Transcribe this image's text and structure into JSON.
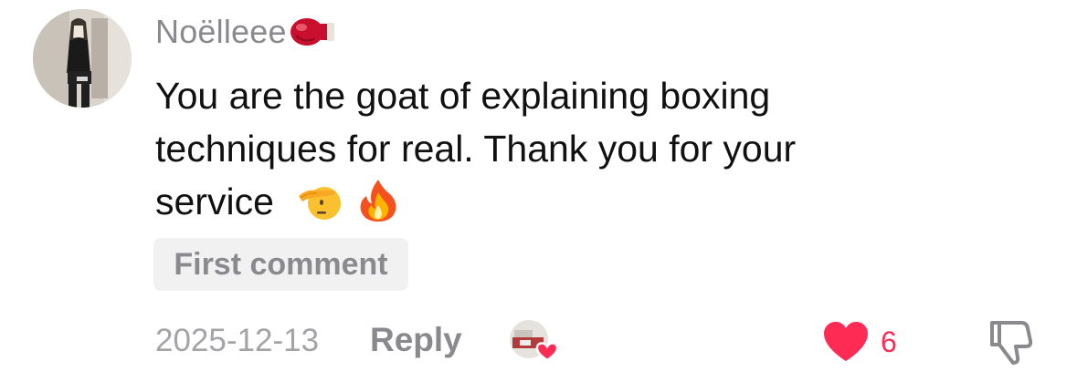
{
  "comment": {
    "username": "Noëlleee",
    "text_line1": "You are the goat of explaining boxing",
    "text_line2": "techniques for real. Thank you for your",
    "text_line3": "service",
    "badge": "First comment",
    "date": "2025-12-13",
    "reply_label": "Reply",
    "like_count": "6"
  },
  "icons": {
    "username_decoration": "boxing-glove-icon",
    "emoji_1": "saluting-face-icon",
    "emoji_2": "fire-icon",
    "creator_liked": "creator-liked-icon",
    "like": "heart-icon",
    "dislike": "thumbs-down-icon"
  },
  "colors": {
    "username": "#8a8a8e",
    "text": "#111111",
    "like_active": "#fe2c55",
    "meta": "#a4a4a8"
  }
}
